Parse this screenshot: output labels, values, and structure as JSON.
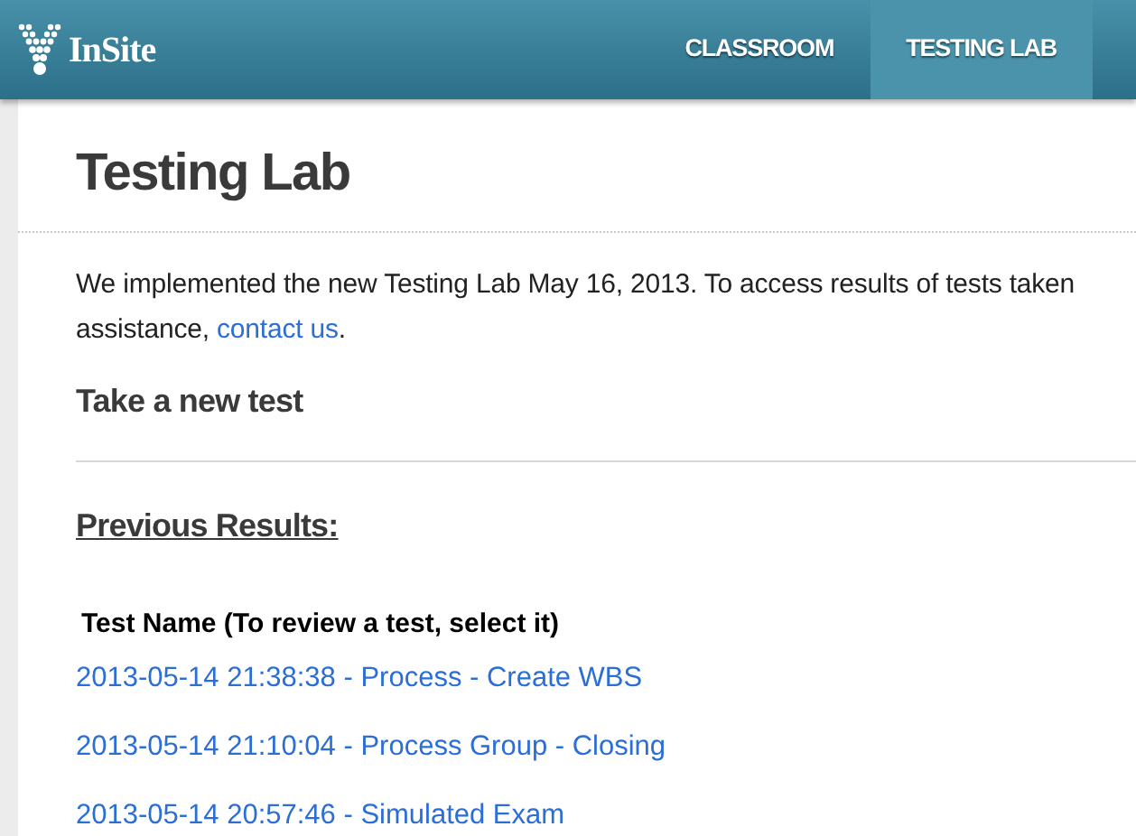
{
  "header": {
    "logo_text": "InSite",
    "nav": [
      {
        "label": "CLASSROOM",
        "selected": false
      },
      {
        "label": "TESTING LAB",
        "selected": true
      }
    ]
  },
  "page_title": "Testing Lab",
  "intro": {
    "line_1": "We implemented the new Testing Lab May 16, 2013. To access results of tests taken",
    "line_2": "assistance, ",
    "link": "contact us",
    "line_end": "."
  },
  "new_test_link": "Take a new test",
  "previous_results": {
    "heading": "Previous Results:",
    "column": "Test Name (To review a test, select it)",
    "rows": [
      "2013-05-14 21:38:38 - Process - Create WBS",
      "2013-05-14 21:10:04 - Process Group - Closing",
      "2013-05-14 20:57:46 - Simulated Exam"
    ]
  }
}
